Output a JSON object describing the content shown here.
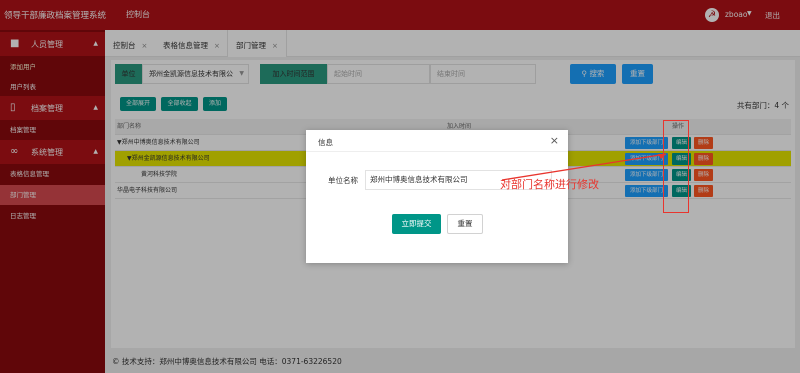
{
  "app": {
    "title": "领导干部廉政档案管理系统",
    "nav_home": "控制台"
  },
  "user": {
    "avatar_glyph": "☭",
    "name": "zboao",
    "logout": "退出"
  },
  "sidebar": {
    "groups": [
      {
        "label": "人员管理",
        "icon": "person-icon",
        "items": [
          "添加用户",
          "用户列表"
        ]
      },
      {
        "label": "档案管理",
        "icon": "document-icon",
        "items": [
          "档案管理"
        ]
      },
      {
        "label": "系统管理",
        "icon": "link-icon",
        "items": [
          "表格信息管理",
          "部门管理",
          "日志管理"
        ]
      }
    ]
  },
  "tabs": [
    "控制台",
    "表格信息管理",
    "部门管理"
  ],
  "filter": {
    "unit_label": "单位",
    "unit_value": "郑州金凯源信息技术有限公",
    "time_label": "加入时间范围",
    "start_placeholder": "起始时间",
    "end_placeholder": "结束时间",
    "search": "搜索",
    "reset": "重置"
  },
  "toolbar": {
    "expand_all": "全部展开",
    "collapse_all": "全部收起",
    "add": "添加"
  },
  "count_text": "共有部门：4 个",
  "table": {
    "headers": {
      "name": "部门名称",
      "time": "加入时间",
      "op": "操作"
    },
    "rows": [
      {
        "name": "▼郑州中博奥信息技术有限公司",
        "time": ""
      },
      {
        "name": "▼郑州金凯源信息技术有限公司",
        "time": ""
      },
      {
        "name": "黄河科技学院",
        "time": ""
      },
      {
        "name": "华晶电子科技有限公司",
        "time": ""
      }
    ],
    "actions": {
      "add_sub": "添加下级部门",
      "edit": "编辑",
      "delete": "删除"
    }
  },
  "footer": "© 技术支持：郑州中博奥信息技术有限公司 电话：0371-63226520",
  "modal": {
    "title": "信息",
    "close": "×",
    "field_label": "单位名称",
    "field_value": "郑州中博奥信息技术有限公司",
    "submit": "立即提交",
    "reset": "重置"
  },
  "annotation": {
    "text": "对部门名称进行修改",
    "color": "#e8352e"
  },
  "colors": {
    "brand": "#b01217",
    "sidebar_dark": "#8a0a0e",
    "teal": "#009688",
    "blue": "#1e9fff",
    "orange": "#ff5722"
  }
}
